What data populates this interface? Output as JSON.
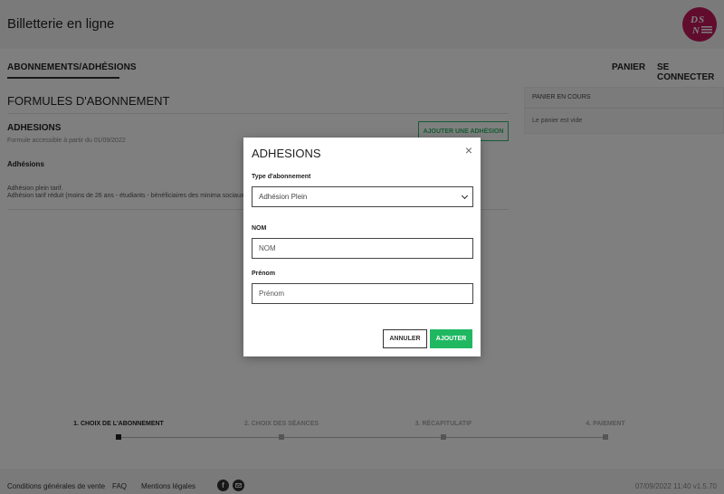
{
  "header": {
    "title": "Billetterie en ligne",
    "logo_icon": "dsn-logo"
  },
  "nav": {
    "tab": "ABONNEMENTS/ADHÉSIONS",
    "cart": "PANIER",
    "login": "SE CONNECTER"
  },
  "main": {
    "title": "FORMULES D'ABONNEMENT",
    "section": {
      "title": "ADHESIONS",
      "date_text": "Formule accessible à partir du 01/09/2022",
      "add_button": "AJOUTER UNE ADHÉSION",
      "group_label": "Adhésions",
      "line1": "Adhésion plein tarif.",
      "line2": "Adhésion tarif réduit (moins de 26 ans - étudiants - bénéficiaires des minima sociaux ou"
    }
  },
  "cart": {
    "title": "PANIER EN COURS",
    "empty": "Le panier est vide"
  },
  "steps": [
    "1. CHOIX DE L'ABONNEMENT",
    "2. CHOIX DES SÉANCES",
    "3. RÉCAPITULATIF",
    "4. PAIEMENT"
  ],
  "footer": {
    "cgv": "Conditions générales de vente",
    "faq": "FAQ",
    "legal": "Mentions légales",
    "meta": "07/09/2022 11:40  v1.5.70",
    "social_icons": [
      "facebook-icon",
      "email-icon"
    ]
  },
  "modal": {
    "title": "ADHESIONS",
    "close": "×",
    "type_label": "Type d'abonnement",
    "type_value": "Adhésion Plein",
    "nom_label": "NOM",
    "nom_placeholder": "NOM",
    "prenom_label": "Prénom",
    "prenom_placeholder": "Prénom",
    "cancel": "ANNULER",
    "submit": "AJOUTER"
  },
  "colors": {
    "accent": "#1fb861",
    "logo": "#c2185b",
    "overlay": "rgba(0,0,0,0.5)"
  }
}
